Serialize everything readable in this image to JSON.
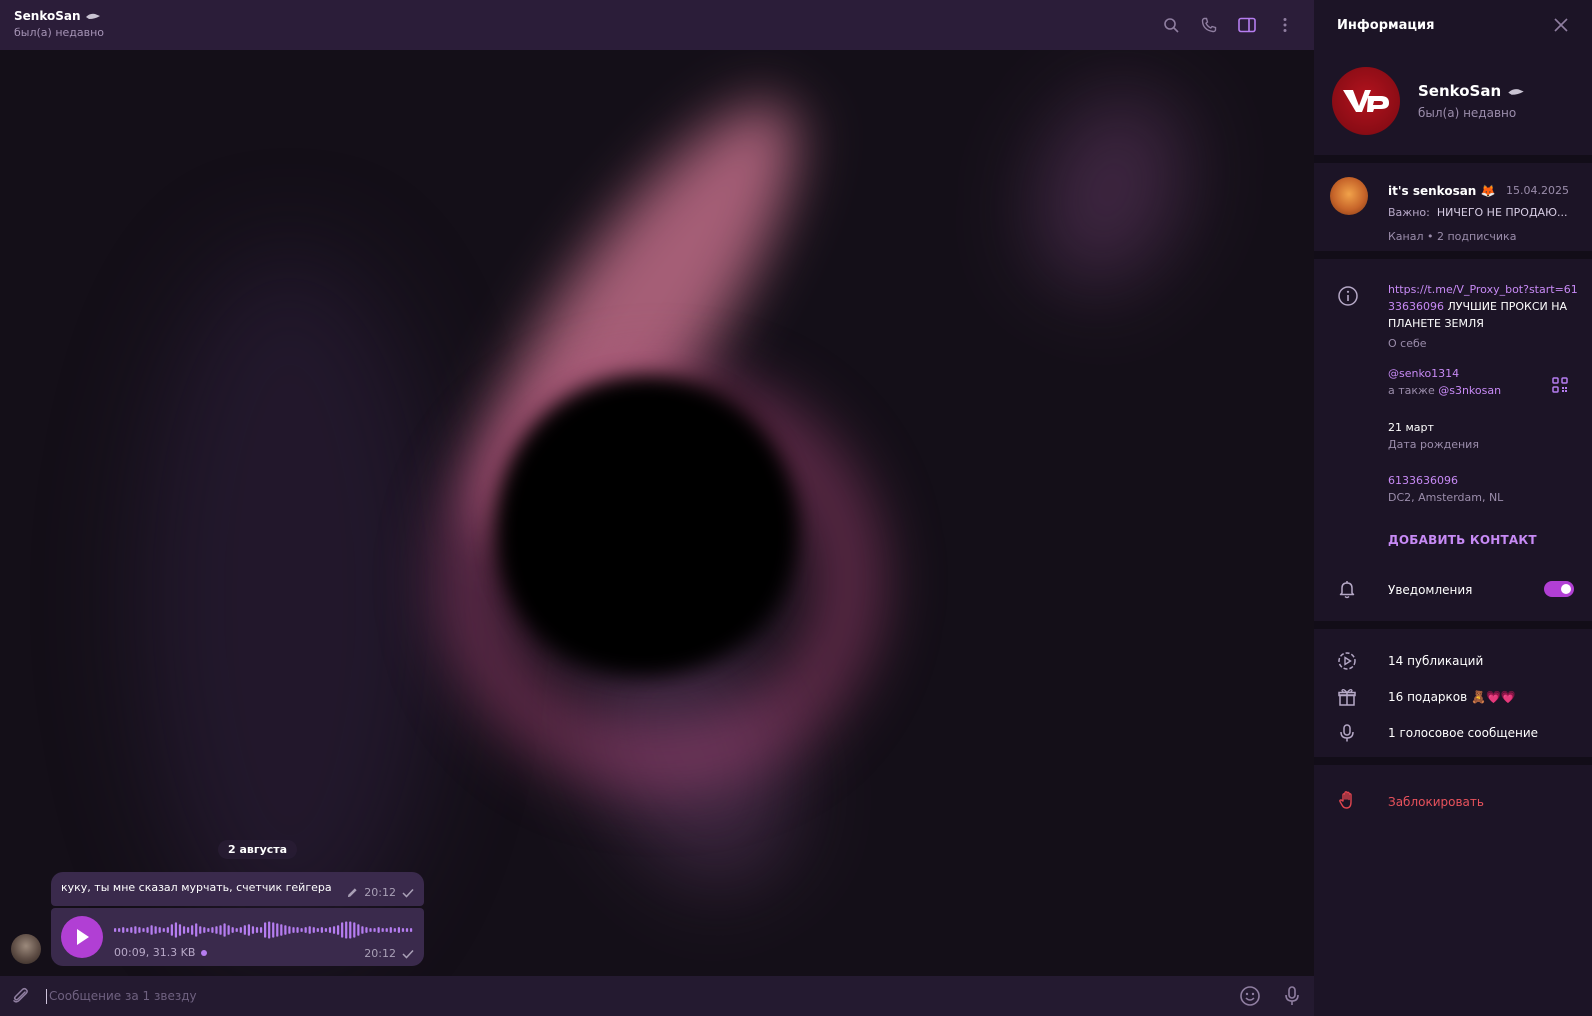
{
  "header": {
    "contact_name": "SenkoSan",
    "contact_status": "был(а) недавно",
    "icons": [
      "search-icon",
      "phone-icon",
      "sidebar-toggle-icon",
      "more-vertical-icon"
    ]
  },
  "chat": {
    "date_pill": "2 августа",
    "messages": [
      {
        "type": "text",
        "text": "куку, ты мне сказал мурчать, счетчик гейгера",
        "time": "20:12",
        "edited": true
      },
      {
        "type": "voice",
        "duration_size": "00:09, 31.3 KB",
        "time": "20:12"
      }
    ]
  },
  "composer": {
    "placeholder": "Сообщение за 1 звезду"
  },
  "panel": {
    "title": "Информация",
    "profile": {
      "name": "SenkoSan",
      "status": "был(а) недавно",
      "avatar_text": "VP"
    },
    "channel": {
      "name": "it's senkosan 🦊",
      "date": "15.04.2025",
      "msg_label": "Важно:",
      "msg_text": "НИЧЕГО НЕ ПРОДАЮ...",
      "subtitle": "Канал • 2 подписчика"
    },
    "bio": {
      "link": "https://t.me/V_Proxy_bot?start=6133636096",
      "text": " ЛУЧШИЕ ПРОКСИ НА ПЛАНЕТЕ ЗЕМЛЯ",
      "label": "О себе"
    },
    "username": {
      "value": "@senko1314",
      "also_prefix": "а также",
      "also_value": "@s3nkosan"
    },
    "birthday": {
      "value": "21 март",
      "label": "Дата рождения"
    },
    "id": {
      "value": "6133636096",
      "label": "DC2, Amsterdam, NL"
    },
    "add_contact": "ДОБАВИТЬ КОНТАКТ",
    "notifications": {
      "label": "Уведомления",
      "enabled": true
    },
    "stats": {
      "posts": "14 публикаций",
      "gifts": "16 подарков 🧸💗💗",
      "voice": "1 голосовое сообщение"
    },
    "block": "Заблокировать"
  },
  "colors": {
    "accent": "#b57df0",
    "header_bg": "#2b1d39",
    "panel_bg": "#1c1426",
    "danger": "#e8525c"
  }
}
